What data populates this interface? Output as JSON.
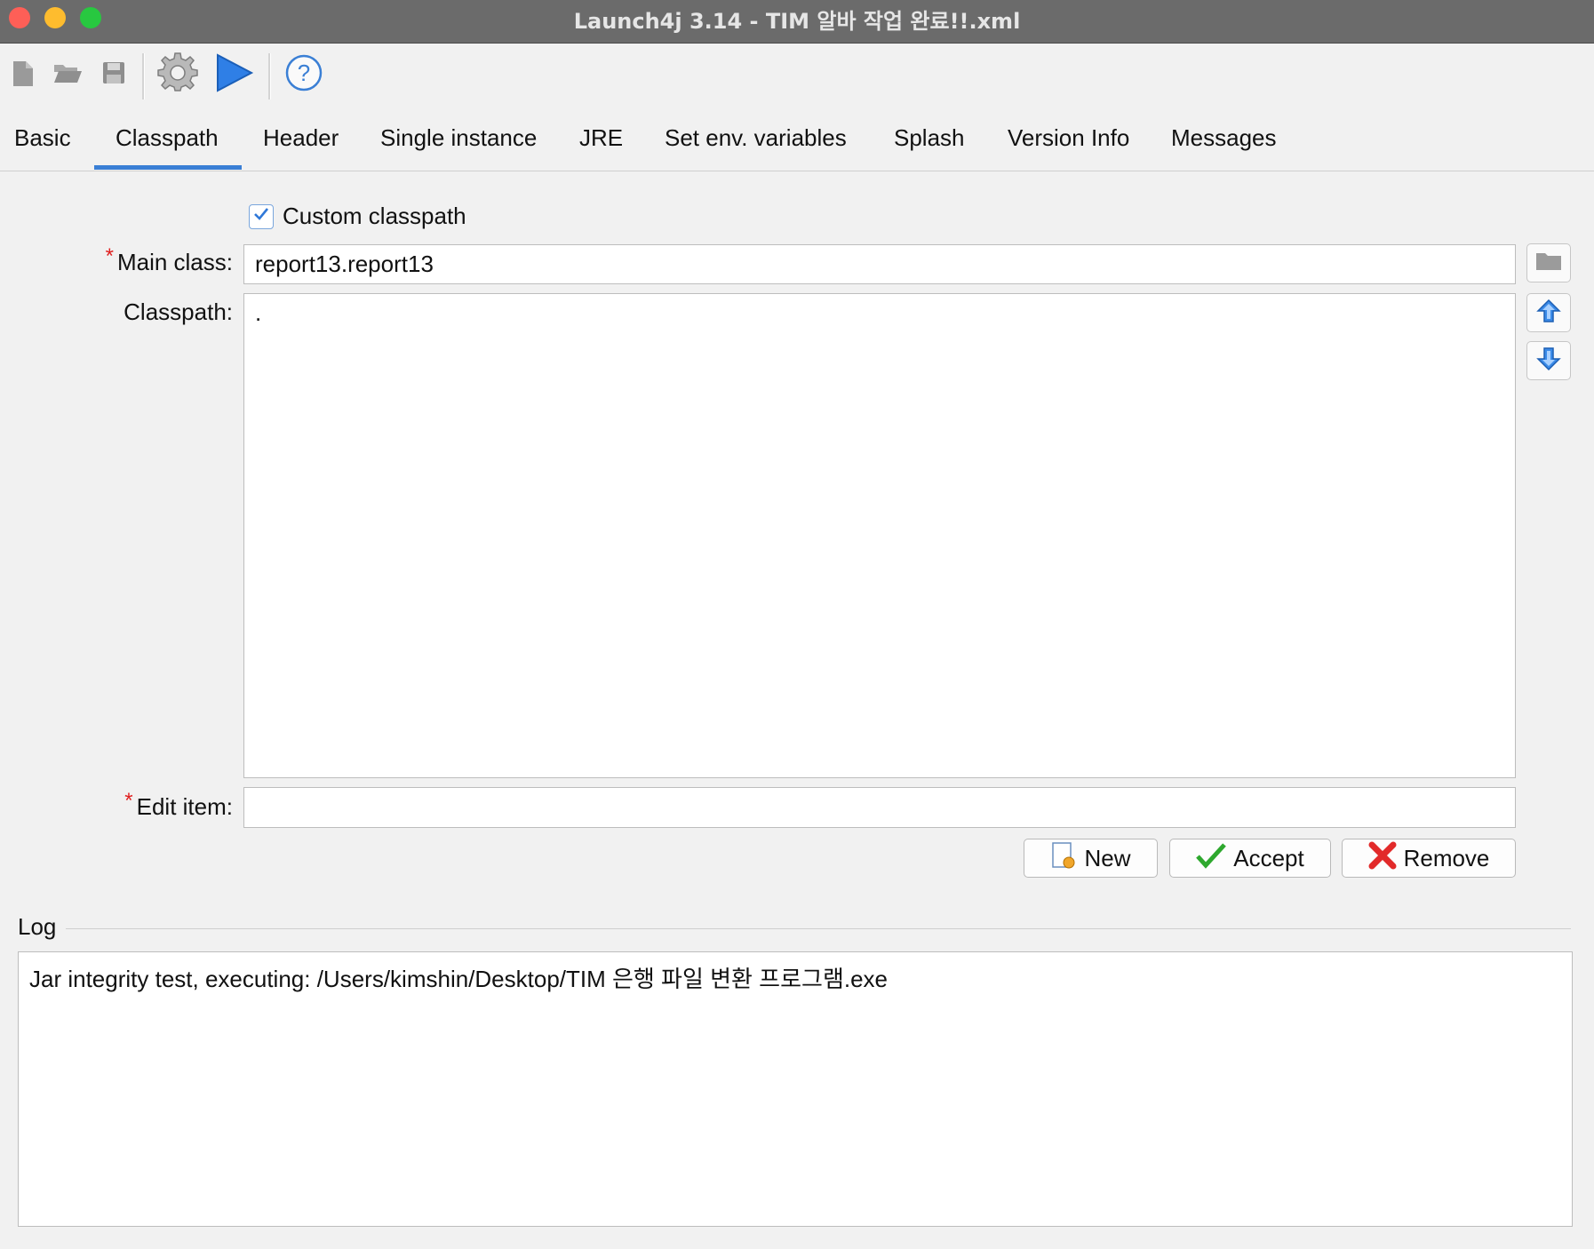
{
  "window": {
    "title": "Launch4j 3.14 - TIM 알바 작업 완료!!.xml"
  },
  "toolbar": {
    "items": [
      "new-file-icon",
      "open-folder-icon",
      "save-icon",
      "settings-gear-icon",
      "run-play-icon",
      "help-icon"
    ]
  },
  "tabs": [
    {
      "label": "Basic"
    },
    {
      "label": "Classpath",
      "active": true
    },
    {
      "label": "Header"
    },
    {
      "label": "Single instance"
    },
    {
      "label": "JRE"
    },
    {
      "label": "Set env. variables"
    },
    {
      "label": "Splash"
    },
    {
      "label": "Version Info"
    },
    {
      "label": "Messages"
    }
  ],
  "form": {
    "custom_classpath_label": "Custom classpath",
    "custom_classpath_checked": true,
    "required_marker": "*",
    "main_class_label": "Main class:",
    "main_class_value": "report13.report13",
    "classpath_label": "Classpath:",
    "classpath_items": [
      "."
    ],
    "edit_item_label": "Edit item:",
    "edit_item_value": ""
  },
  "buttons": {
    "new_label": "New",
    "accept_label": "Accept",
    "remove_label": "Remove"
  },
  "log": {
    "label": "Log",
    "text": "Jar integrity test, executing: /Users/kimshin/Desktop/TIM 은행 파일 변환 프로그램.exe"
  },
  "colors": {
    "accent": "#3a7fd5",
    "required": "#e02020",
    "titlebar": "#6b6b6b"
  }
}
